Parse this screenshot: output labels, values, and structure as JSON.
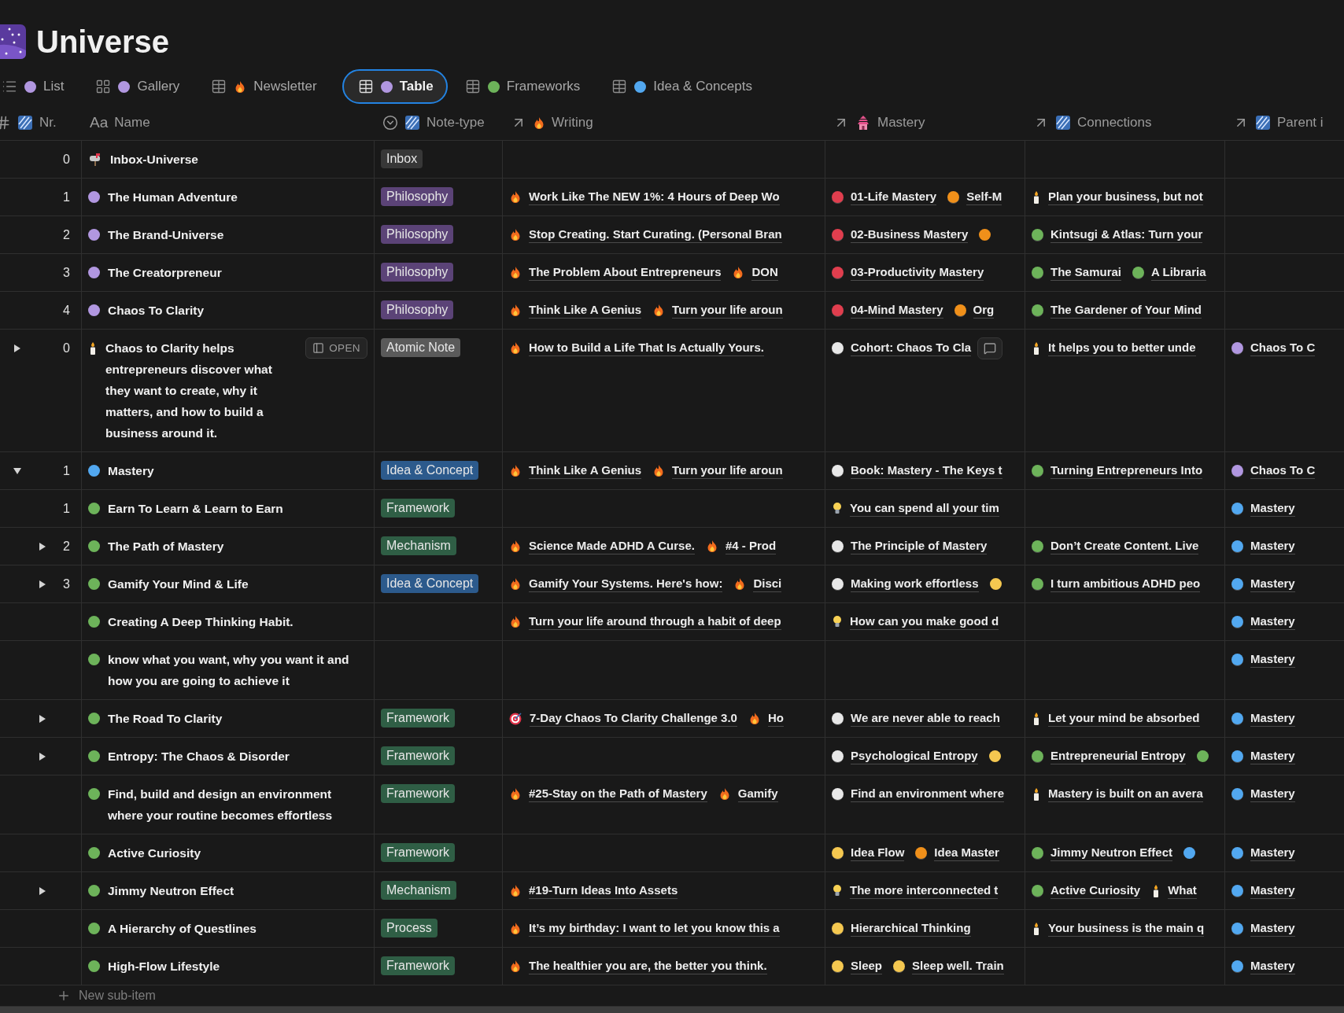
{
  "page": {
    "title": "Universe"
  },
  "tabs": [
    {
      "label": "List",
      "kind": "list",
      "badge": {
        "kind": "dot",
        "color": "#b197e0"
      },
      "selected": false
    },
    {
      "label": "Gallery",
      "kind": "gallery",
      "badge": {
        "kind": "dot",
        "color": "#b197e0"
      },
      "selected": false
    },
    {
      "label": "Newsletter",
      "kind": "table",
      "badge": {
        "kind": "fire"
      },
      "selected": false
    },
    {
      "label": "Table",
      "kind": "table",
      "badge": {
        "kind": "dot",
        "color": "#b197e0"
      },
      "selected": true
    },
    {
      "label": "Frameworks",
      "kind": "table",
      "badge": {
        "kind": "dot",
        "color": "#6db35a"
      },
      "selected": false
    },
    {
      "label": "Idea & Concepts",
      "kind": "table",
      "badge": {
        "kind": "dot",
        "color": "#52a8f0"
      },
      "selected": false
    }
  ],
  "columns": [
    {
      "kind": "number",
      "badge": {
        "kind": "stripe"
      },
      "label": "Nr."
    },
    {
      "kind": "title",
      "type_text": "Aa",
      "label": "Name"
    },
    {
      "kind": "select",
      "badge": {
        "kind": "stripe"
      },
      "label": "Note-type"
    },
    {
      "kind": "relation",
      "badge": {
        "kind": "fire"
      },
      "label": "Writing"
    },
    {
      "kind": "relation",
      "badge": {
        "kind": "pagoda"
      },
      "label": "Mastery"
    },
    {
      "kind": "relation",
      "badge": {
        "kind": "stripe"
      },
      "label": "Connections"
    },
    {
      "kind": "relation",
      "badge": {
        "kind": "stripe"
      },
      "label": "Parent i"
    }
  ],
  "rows": [
    {
      "nr": "0",
      "icon": {
        "kind": "mailbox"
      },
      "name": "Inbox-Universe",
      "note_type": {
        "label": "Inbox",
        "color": "#373737"
      }
    },
    {
      "nr": "1",
      "icon": {
        "kind": "dot",
        "color": "#b197e0"
      },
      "name": "The Human Adventure",
      "note_type": {
        "label": "Philosophy",
        "color": "#5b4377"
      },
      "writing": [
        {
          "kind": "fire",
          "text": "Work Like The NEW 1%: 4 Hours of Deep Wo"
        }
      ],
      "mastery": [
        {
          "kind": "dot",
          "color": "#e03e4e",
          "text": "01-Life Mastery"
        },
        {
          "kind": "dot",
          "color": "#f0901a",
          "text": "Self-M"
        }
      ],
      "connections": [
        {
          "kind": "candle",
          "text": "Plan your business, but not"
        }
      ]
    },
    {
      "nr": "2",
      "icon": {
        "kind": "dot",
        "color": "#b197e0"
      },
      "name": "The Brand-Universe",
      "note_type": {
        "label": "Philosophy",
        "color": "#5b4377"
      },
      "writing": [
        {
          "kind": "fire",
          "text": "Stop Creating. Start Curating. (Personal Bran"
        }
      ],
      "mastery": [
        {
          "kind": "dot",
          "color": "#e03e4e",
          "text": "02-Business Mastery"
        },
        {
          "kind": "dot",
          "color": "#f0901a"
        }
      ],
      "connections": [
        {
          "kind": "dot",
          "color": "#6db35a",
          "text": "Kintsugi & Atlas: Turn your"
        }
      ]
    },
    {
      "nr": "3",
      "icon": {
        "kind": "dot",
        "color": "#b197e0"
      },
      "name": "The Creatorpreneur",
      "note_type": {
        "label": "Philosophy",
        "color": "#5b4377"
      },
      "writing": [
        {
          "kind": "fire",
          "text": "The Problem About Entrepreneurs"
        },
        {
          "kind": "fire",
          "text": "DON"
        }
      ],
      "mastery": [
        {
          "kind": "dot",
          "color": "#e03e4e",
          "text": "03-Productivity Mastery"
        }
      ],
      "connections": [
        {
          "kind": "dot",
          "color": "#6db35a",
          "text": "The Samurai"
        },
        {
          "kind": "dot",
          "color": "#6db35a",
          "text": "A Libraria"
        }
      ]
    },
    {
      "nr": "4",
      "icon": {
        "kind": "dot",
        "color": "#b197e0"
      },
      "name": "Chaos To Clarity",
      "note_type": {
        "label": "Philosophy",
        "color": "#5b4377"
      },
      "writing": [
        {
          "kind": "fire",
          "text": "Think Like A Genius"
        },
        {
          "kind": "fire",
          "text": "Turn your life aroun"
        }
      ],
      "mastery": [
        {
          "kind": "dot",
          "color": "#e03e4e",
          "text": "04-Mind Mastery"
        },
        {
          "kind": "dot",
          "color": "#f0901a",
          "text": "Org"
        }
      ],
      "connections": [
        {
          "kind": "dot",
          "color": "#6db35a",
          "text": "The Gardener of Your Mind"
        }
      ]
    },
    {
      "nr": "0",
      "expanded": false,
      "icon": {
        "kind": "candle"
      },
      "name": "Chaos to Clarity helps entrepreneurs discover what they want to create, why it matters, and how to build a business around it.",
      "open_button": "OPEN",
      "note_type": {
        "label": "Atomic Note",
        "color": "#5a5a5a"
      },
      "writing": [
        {
          "kind": "fire",
          "text": "How to Build a Life That Is Actually Yours."
        }
      ],
      "mastery": [
        {
          "kind": "dot",
          "color": "#e8e8e8",
          "text": "Cohort: Chaos To Cla"
        }
      ],
      "comment_button": true,
      "connections": [
        {
          "kind": "candle",
          "text": "It helps you to better unde"
        }
      ],
      "parent": [
        {
          "kind": "dot",
          "color": "#b197e0",
          "text": "Chaos To C"
        }
      ]
    },
    {
      "nr": "1",
      "expanded": true,
      "icon": {
        "kind": "dot",
        "color": "#52a8f0"
      },
      "name": "Mastery",
      "note_type": {
        "label": "Idea & Concept",
        "color": "#2c5a8c"
      },
      "writing": [
        {
          "kind": "fire",
          "text": "Think Like A Genius"
        },
        {
          "kind": "fire",
          "text": "Turn your life aroun"
        }
      ],
      "mastery": [
        {
          "kind": "dot",
          "color": "#e8e8e8",
          "text": "Book: Mastery - The Keys t"
        }
      ],
      "connections": [
        {
          "kind": "dot",
          "color": "#6db35a",
          "text": "Turning Entrepreneurs Into"
        }
      ],
      "parent": [
        {
          "kind": "dot",
          "color": "#b197e0",
          "text": "Chaos To C"
        }
      ],
      "new_item": "New sub-item",
      "children": [
        {
          "nr": "1",
          "icon": {
            "kind": "dot",
            "color": "#6db35a"
          },
          "name": "Earn To Learn & Learn to Earn",
          "note_type": {
            "label": "Framework",
            "color": "#2f5e45"
          },
          "mastery": [
            {
              "kind": "bulb",
              "text": "You can spend all your tim"
            }
          ],
          "parent": [
            {
              "kind": "dot",
              "color": "#52a8f0",
              "text": "Mastery"
            }
          ]
        },
        {
          "nr": "2",
          "expanded": false,
          "icon": {
            "kind": "dot",
            "color": "#6db35a"
          },
          "name": "The Path of Mastery",
          "note_type": {
            "label": "Mechanism",
            "color": "#2f5e45"
          },
          "writing": [
            {
              "kind": "fire",
              "text": "Science Made ADHD A Curse."
            },
            {
              "kind": "fire",
              "text": "#4 - Prod"
            }
          ],
          "mastery": [
            {
              "kind": "dot",
              "color": "#e8e8e8",
              "text": "The Principle of Mastery"
            }
          ],
          "connections": [
            {
              "kind": "dot",
              "color": "#6db35a",
              "text": "Don’t Create Content. Live"
            }
          ],
          "parent": [
            {
              "kind": "dot",
              "color": "#52a8f0",
              "text": "Mastery"
            }
          ]
        },
        {
          "nr": "3",
          "expanded": false,
          "icon": {
            "kind": "dot",
            "color": "#6db35a"
          },
          "name": "Gamify Your Mind & Life",
          "note_type": {
            "label": "Idea & Concept",
            "color": "#2c5a8c"
          },
          "writing": [
            {
              "kind": "fire",
              "text": "Gamify Your Systems. Here's how:"
            },
            {
              "kind": "fire",
              "text": "Disci"
            }
          ],
          "mastery": [
            {
              "kind": "dot",
              "color": "#e8e8e8",
              "text": "Making work effortless"
            },
            {
              "kind": "dot",
              "color": "#f5c850"
            }
          ],
          "connections": [
            {
              "kind": "dot",
              "color": "#6db35a",
              "text": "I turn ambitious ADHD peo"
            }
          ],
          "parent": [
            {
              "kind": "dot",
              "color": "#52a8f0",
              "text": "Mastery"
            }
          ]
        },
        {
          "icon": {
            "kind": "dot",
            "color": "#6db35a"
          },
          "name": "Creating A Deep Thinking Habit.",
          "writing": [
            {
              "kind": "fire",
              "text": "Turn your life around through a habit of deep"
            }
          ],
          "mastery": [
            {
              "kind": "bulb",
              "text": "How can you make good d"
            }
          ],
          "parent": [
            {
              "kind": "dot",
              "color": "#52a8f0",
              "text": "Mastery"
            }
          ]
        },
        {
          "icon": {
            "kind": "dot",
            "color": "#6db35a"
          },
          "name": "know what you want, why you want it and how you are going to achieve it",
          "parent": [
            {
              "kind": "dot",
              "color": "#52a8f0",
              "text": "Mastery"
            }
          ]
        },
        {
          "expanded": false,
          "icon": {
            "kind": "dot",
            "color": "#6db35a"
          },
          "name": "The Road To Clarity",
          "note_type": {
            "label": "Framework",
            "color": "#2f5e45"
          },
          "writing": [
            {
              "kind": "target",
              "text": "7-Day Chaos To Clarity Challenge 3.0"
            },
            {
              "kind": "fire",
              "text": "Ho"
            }
          ],
          "mastery": [
            {
              "kind": "dot",
              "color": "#e8e8e8",
              "text": "We are never able to reach"
            }
          ],
          "connections": [
            {
              "kind": "candle",
              "text": "Let your mind be absorbed"
            }
          ],
          "parent": [
            {
              "kind": "dot",
              "color": "#52a8f0",
              "text": "Mastery"
            }
          ]
        },
        {
          "expanded": false,
          "icon": {
            "kind": "dot",
            "color": "#6db35a"
          },
          "name": "Entropy: The Chaos & Disorder",
          "note_type": {
            "label": "Framework",
            "color": "#2f5e45"
          },
          "mastery": [
            {
              "kind": "dot",
              "color": "#e8e8e8",
              "text": "Psychological Entropy"
            },
            {
              "kind": "dot",
              "color": "#f5c850"
            }
          ],
          "connections": [
            {
              "kind": "dot",
              "color": "#6db35a",
              "text": "Entrepreneurial Entropy"
            },
            {
              "kind": "dot",
              "color": "#6db35a"
            }
          ],
          "parent": [
            {
              "kind": "dot",
              "color": "#52a8f0",
              "text": "Mastery"
            }
          ]
        },
        {
          "icon": {
            "kind": "dot",
            "color": "#6db35a"
          },
          "name": "Find, build and design an environment where your routine becomes effortless",
          "note_type": {
            "label": "Framework",
            "color": "#2f5e45"
          },
          "writing": [
            {
              "kind": "fire",
              "text": "#25-Stay on the Path of Mastery"
            },
            {
              "kind": "fire",
              "text": "Gamify"
            }
          ],
          "mastery": [
            {
              "kind": "dot",
              "color": "#e8e8e8",
              "text": "Find an environment where"
            }
          ],
          "connections": [
            {
              "kind": "candle",
              "text": "Mastery is built on an avera"
            }
          ],
          "parent": [
            {
              "kind": "dot",
              "color": "#52a8f0",
              "text": "Mastery"
            }
          ]
        },
        {
          "icon": {
            "kind": "dot",
            "color": "#6db35a"
          },
          "name": "Active Curiosity",
          "note_type": {
            "label": "Framework",
            "color": "#2f5e45"
          },
          "mastery": [
            {
              "kind": "dot",
              "color": "#f5c850",
              "text": "Idea Flow"
            },
            {
              "kind": "dot",
              "color": "#f0901a",
              "text": "Idea Master"
            }
          ],
          "connections": [
            {
              "kind": "dot",
              "color": "#6db35a",
              "text": "Jimmy Neutron Effect"
            },
            {
              "kind": "dot",
              "color": "#52a8f0"
            }
          ],
          "parent": [
            {
              "kind": "dot",
              "color": "#52a8f0",
              "text": "Mastery"
            }
          ]
        },
        {
          "expanded": false,
          "icon": {
            "kind": "dot",
            "color": "#6db35a"
          },
          "name": "Jimmy Neutron Effect",
          "note_type": {
            "label": "Mechanism",
            "color": "#2f5e45"
          },
          "writing": [
            {
              "kind": "fire",
              "text": "#19-Turn Ideas Into Assets"
            }
          ],
          "mastery": [
            {
              "kind": "bulb",
              "text": "The more interconnected t"
            }
          ],
          "connections": [
            {
              "kind": "dot",
              "color": "#6db35a",
              "text": "Active Curiosity"
            },
            {
              "kind": "candle",
              "text": "What"
            }
          ],
          "parent": [
            {
              "kind": "dot",
              "color": "#52a8f0",
              "text": "Mastery"
            }
          ]
        },
        {
          "icon": {
            "kind": "dot",
            "color": "#6db35a"
          },
          "name": "A Hierarchy of Questlines",
          "note_type": {
            "label": "Process",
            "color": "#2f5e45"
          },
          "writing": [
            {
              "kind": "fire",
              "text": "It’s my birthday: I want to let you know this a"
            }
          ],
          "mastery": [
            {
              "kind": "dot",
              "color": "#f5c850",
              "text": "Hierarchical Thinking"
            }
          ],
          "connections": [
            {
              "kind": "candle",
              "text": "Your business is the main q"
            }
          ],
          "parent": [
            {
              "kind": "dot",
              "color": "#52a8f0",
              "text": "Mastery"
            }
          ]
        },
        {
          "icon": {
            "kind": "dot",
            "color": "#6db35a"
          },
          "name": "High-Flow Lifestyle",
          "note_type": {
            "label": "Framework",
            "color": "#2f5e45"
          },
          "writing": [
            {
              "kind": "fire",
              "text": "The healthier you are, the better you think."
            }
          ],
          "mastery": [
            {
              "kind": "dot",
              "color": "#f5c850",
              "text": "Sleep"
            },
            {
              "kind": "dot",
              "color": "#f5c850",
              "text": "Sleep well. Train"
            }
          ],
          "parent": [
            {
              "kind": "dot",
              "color": "#52a8f0",
              "text": "Mastery"
            }
          ]
        }
      ]
    }
  ]
}
